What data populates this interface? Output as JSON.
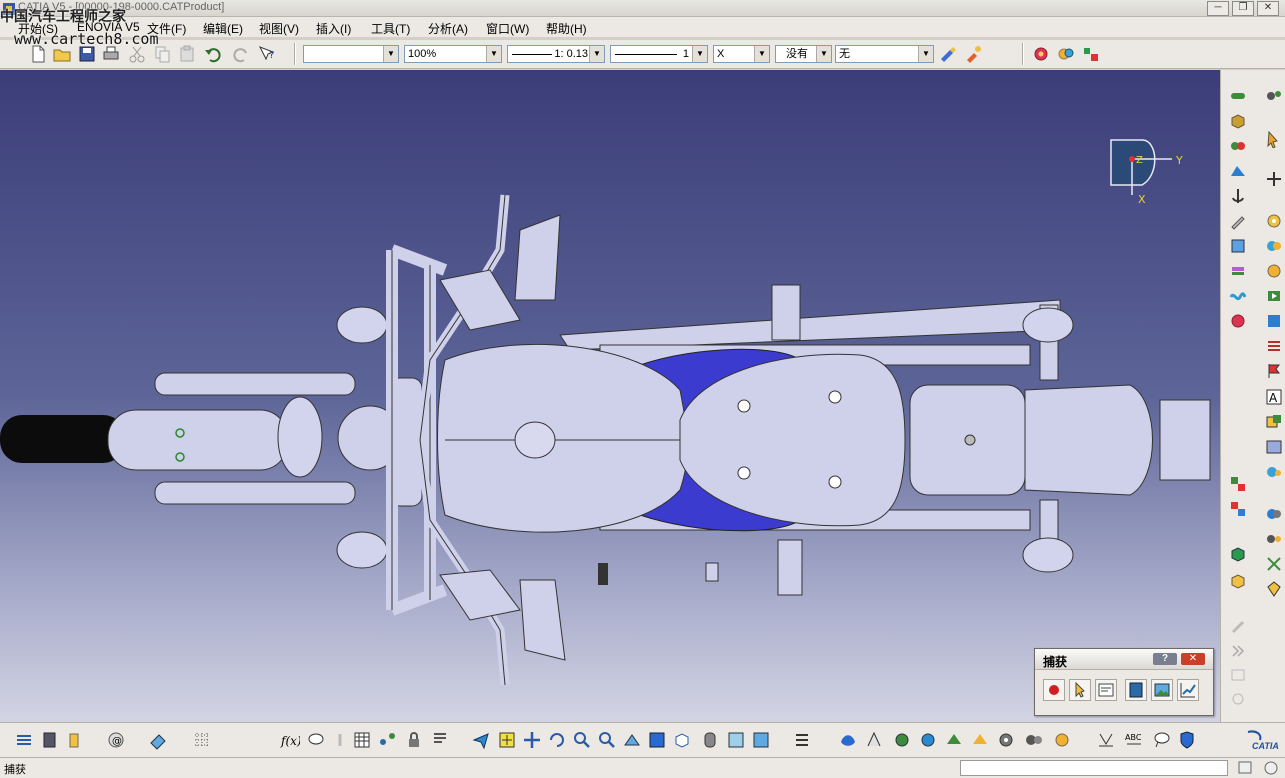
{
  "window": {
    "title": "CATIA V5 - [00000-198-0000.CATProduct]",
    "buttons": [
      "─",
      "❐",
      "✕"
    ]
  },
  "watermark": {
    "line1": "中国汽车工程师之家",
    "line2": "www.cartech8.com"
  },
  "menu": [
    "开始(S)",
    "ENOVIA V5",
    "文件(F)",
    "编辑(E)",
    "视图(V)",
    "插入(I)",
    "工具(T)",
    "分析(A)",
    "窗口(W)",
    "帮助(H)"
  ],
  "toolbar": {
    "combos": [
      "",
      "100%",
      "1: 0.13",
      "1",
      "X",
      "没有",
      "无"
    ]
  },
  "compass": {
    "axes": [
      "Z",
      "Y",
      "X"
    ]
  },
  "capture_panel": {
    "title": "捕获",
    "help": "?",
    "close": "✕"
  },
  "status": {
    "text": "捕获"
  },
  "brand": {
    "logo_text": "CATIA"
  },
  "colors": {
    "viewport_top": "#3b3d78",
    "viewport_bottom": "#d3d4e3",
    "tank": "#3b3ccf",
    "part": "#cfd0ea",
    "accent": "#0a246a"
  }
}
